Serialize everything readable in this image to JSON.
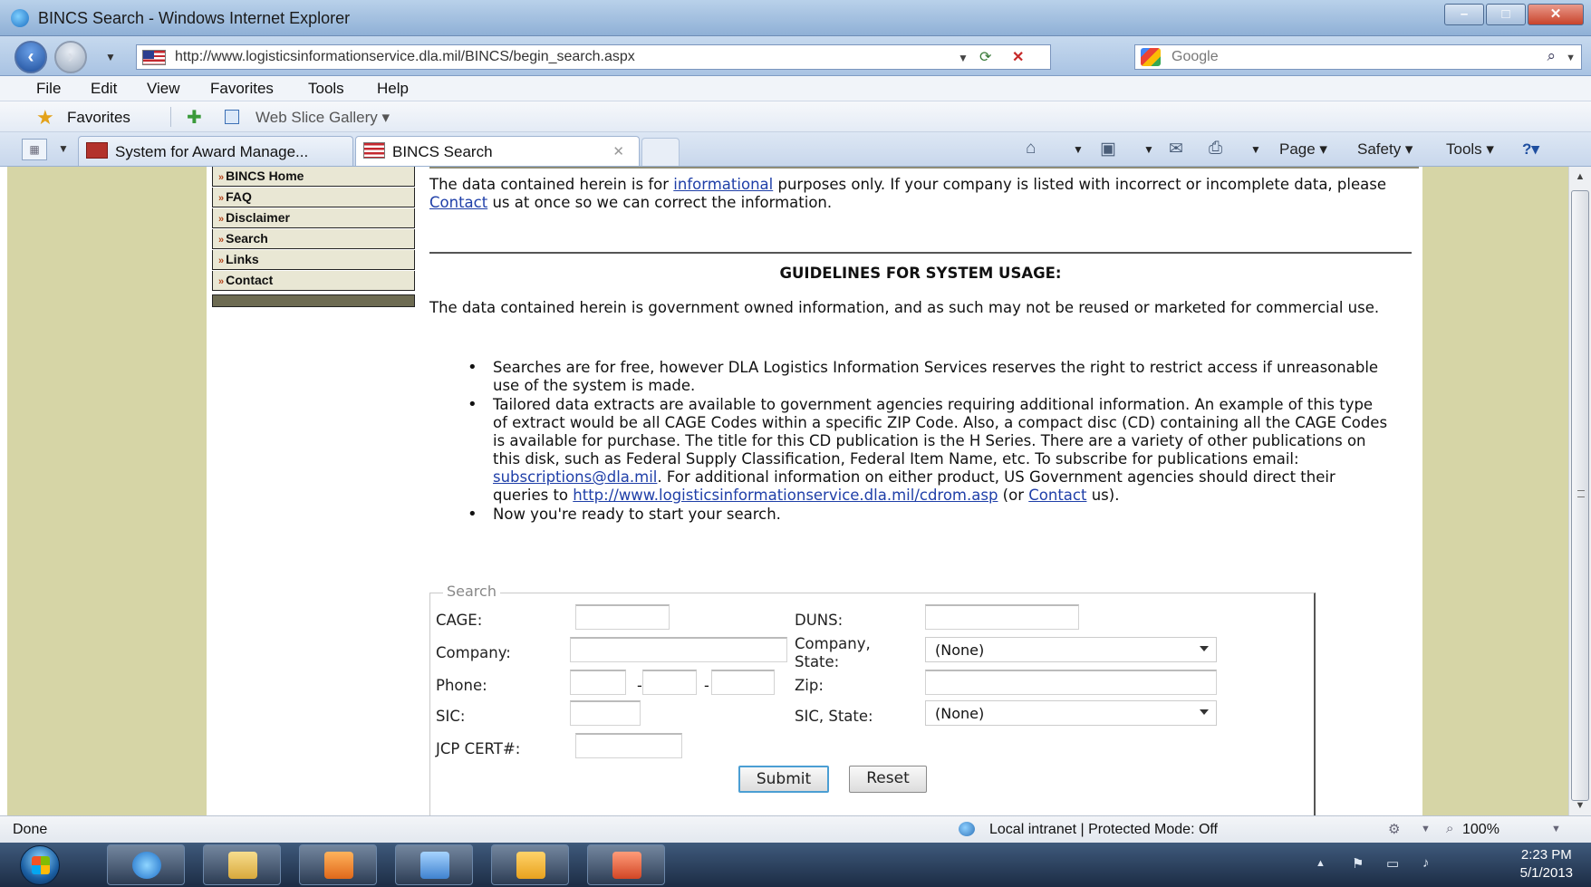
{
  "window": {
    "title": "BINCS Search - Windows Internet Explorer",
    "minimize": "–",
    "maximize": "□",
    "close": "✕"
  },
  "address_bar": {
    "url": "http://www.logisticsinformationservice.dla.mil/BINCS/begin_search.aspx",
    "search_engine": "Google",
    "refresh_icon": "refresh-icon",
    "stop_icon": "stop-icon"
  },
  "menu": [
    "File",
    "Edit",
    "View",
    "Favorites",
    "Tools",
    "Help"
  ],
  "favorites_bar": {
    "favorites_label": "Favorites",
    "web_slice_gallery": "Web Slice Gallery ▾"
  },
  "tabs": [
    {
      "label": "System for Award Manage...",
      "active": false
    },
    {
      "label": "BINCS Search",
      "active": true
    }
  ],
  "command_bar": {
    "page": "Page ▾",
    "safety": "Safety ▾",
    "tools": "Tools ▾",
    "help": "?▾"
  },
  "sidenav": {
    "items": [
      {
        "label": "BINCS Home"
      },
      {
        "label": "FAQ"
      },
      {
        "label": "Disclaimer"
      },
      {
        "label": "Search"
      },
      {
        "label": "Links"
      },
      {
        "label": "Contact"
      }
    ],
    "arrow": "»"
  },
  "content": {
    "p1_a": "The data contained herein is for ",
    "p1_link1": "informational",
    "p1_b": "  purposes only. If your company is listed with incorrect or incomplete data, please ",
    "p1_link2": "Contact",
    "p1_c": " us at once so we can correct the information.",
    "guidelines_heading": "GUIDELINES FOR SYSTEM USAGE:",
    "p2": "The data contained herein is government owned information, and as such may not be reused or marketed for commercial use.",
    "bullet1": "Searches are for free, however DLA Logistics Information Services reserves the right to restrict access if unreasonable use of the system is made.",
    "bullet2_a": "Tailored data extracts are available to government agencies requiring additional information. An example of this type of extract would be all CAGE Codes within a specific ZIP Code. Also, a compact disc (CD) containing all the CAGE Codes is available for purchase. The title for this CD publication is the H Series. There are a variety of other publications on this disk, such as Federal Supply Classification, Federal Item Name, etc. To subscribe for publications email: ",
    "bullet2_email": "subscriptions@dla.mil",
    "bullet2_b": ". For additional information on either product, US Government agencies should direct their queries to ",
    "bullet2_url": "http://www.logisticsinformationservice.dla.mil/cdrom.asp",
    "bullet2_c": " (or ",
    "bullet2_contact": "Contact",
    "bullet2_d": " us).",
    "bullet3": "Now you're ready to start your search."
  },
  "search_form": {
    "legend": "Search",
    "cage_label": "CAGE:",
    "duns_label": "DUNS:",
    "company_label": "Company:",
    "company_state_label_1": "Company,",
    "company_state_label_2": "State:",
    "company_state_value": "(None)",
    "phone_label": "Phone:",
    "phone_dash": "-",
    "zip_label": "Zip:",
    "sic_label": "SIC:",
    "sic_state_label": "SIC, State:",
    "sic_state_value": "(None)",
    "jcp_label": "JCP CERT#:",
    "submit": "Submit",
    "reset": "Reset"
  },
  "status_bar": {
    "status": "Done",
    "zone": "Local intranet | Protected Mode: Off",
    "zoom": "100%"
  },
  "taskbar": {
    "time": "2:23 PM",
    "date": "5/1/2013"
  }
}
